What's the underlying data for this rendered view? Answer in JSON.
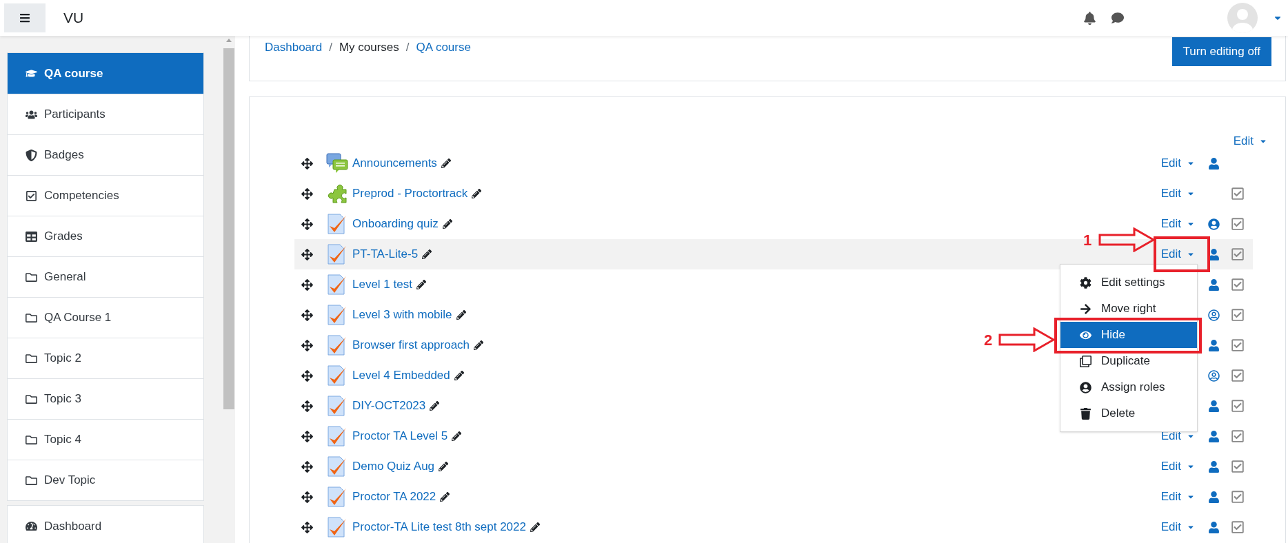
{
  "top_bar": {
    "site_name": "VU"
  },
  "sidebar": {
    "items": [
      {
        "label": "QA course",
        "kind": "course",
        "selected": true
      },
      {
        "label": "Participants",
        "kind": "users",
        "selected": false
      },
      {
        "label": "Badges",
        "kind": "shield",
        "selected": false
      },
      {
        "label": "Competencies",
        "kind": "checkbox",
        "selected": false
      },
      {
        "label": "Grades",
        "kind": "table",
        "selected": false
      },
      {
        "label": "General",
        "kind": "folder",
        "selected": false
      },
      {
        "label": "QA Course 1",
        "kind": "folder",
        "selected": false
      },
      {
        "label": "Topic 2",
        "kind": "folder",
        "selected": false
      },
      {
        "label": "Topic 3",
        "kind": "folder",
        "selected": false
      },
      {
        "label": "Topic 4",
        "kind": "folder",
        "selected": false
      },
      {
        "label": "Dev Topic",
        "kind": "folder",
        "selected": false
      }
    ],
    "footer_items": [
      {
        "label": "Dashboard",
        "kind": "gauge",
        "selected": false
      }
    ]
  },
  "breadcrumb": [
    {
      "text": "Dashboard",
      "kind": "link"
    },
    {
      "text": "/",
      "kind": "separator"
    },
    {
      "text": "My courses",
      "kind": "current"
    },
    {
      "text": "/",
      "kind": "separator"
    },
    {
      "text": "QA course",
      "kind": "link"
    }
  ],
  "editing_button": "Turn editing off",
  "section": {
    "edit_menu": "Edit",
    "activities": [
      {
        "name": "Announcements",
        "kind": "forum",
        "edit": "Edit",
        "access": {
          "kind": "user"
        },
        "completion": false,
        "selected": false
      },
      {
        "name": "Preprod - Proctortrack",
        "kind": "plugin",
        "edit": "Edit",
        "completion": true,
        "selected": false
      },
      {
        "name": "Onboarding quiz",
        "kind": "quiz",
        "edit": "Edit",
        "access": {
          "kind": "user-circle"
        },
        "completion": true,
        "selected": false
      },
      {
        "name": "PT-TA-Lite-5",
        "kind": "quiz",
        "edit": "Edit",
        "access": {
          "kind": "user"
        },
        "completion": true,
        "selected": true
      },
      {
        "name": "Level 1 test",
        "kind": "quiz",
        "access": {
          "kind": "user"
        },
        "completion": true,
        "selected": false
      },
      {
        "name": "Level 3 with mobile",
        "kind": "quiz",
        "access": {
          "kind": "user-circle-outline"
        },
        "completion": true,
        "selected": false
      },
      {
        "name": "Browser first approach",
        "kind": "quiz",
        "access": {
          "kind": "user"
        },
        "completion": true,
        "selected": false
      },
      {
        "name": "Level 4 Embedded",
        "kind": "quiz",
        "access": {
          "kind": "user-circle-outline"
        },
        "completion": true,
        "selected": false
      },
      {
        "name": "DIY-OCT2023",
        "kind": "quiz",
        "access": {
          "kind": "user"
        },
        "completion": true,
        "selected": false
      },
      {
        "name": "Proctor TA Level 5",
        "kind": "quiz",
        "edit": "Edit",
        "access": {
          "kind": "user"
        },
        "completion": true,
        "selected": false
      },
      {
        "name": "Demo Quiz Aug",
        "kind": "quiz",
        "edit": "Edit",
        "access": {
          "kind": "user"
        },
        "completion": true,
        "selected": false
      },
      {
        "name": "Proctor TA 2022",
        "kind": "quiz",
        "edit": "Edit",
        "access": {
          "kind": "user"
        },
        "completion": true,
        "selected": false
      },
      {
        "name": "Proctor-TA Lite test 8th sept 2022",
        "kind": "quiz",
        "edit": "Edit",
        "access": {
          "kind": "user"
        },
        "completion": true,
        "selected": false
      }
    ],
    "menu": [
      {
        "label": "Edit settings",
        "kind": "gear",
        "selected": false
      },
      {
        "label": "Move right",
        "kind": "arrow",
        "selected": false
      },
      {
        "label": "Hide",
        "kind": "eye",
        "selected": true
      },
      {
        "label": "Duplicate",
        "kind": "copy",
        "selected": false
      },
      {
        "label": "Assign roles",
        "kind": "user-circle",
        "selected": false
      },
      {
        "label": "Delete",
        "kind": "trash",
        "selected": false
      }
    ]
  },
  "annotations": [
    {
      "label": "1"
    },
    {
      "label": "2"
    }
  ]
}
